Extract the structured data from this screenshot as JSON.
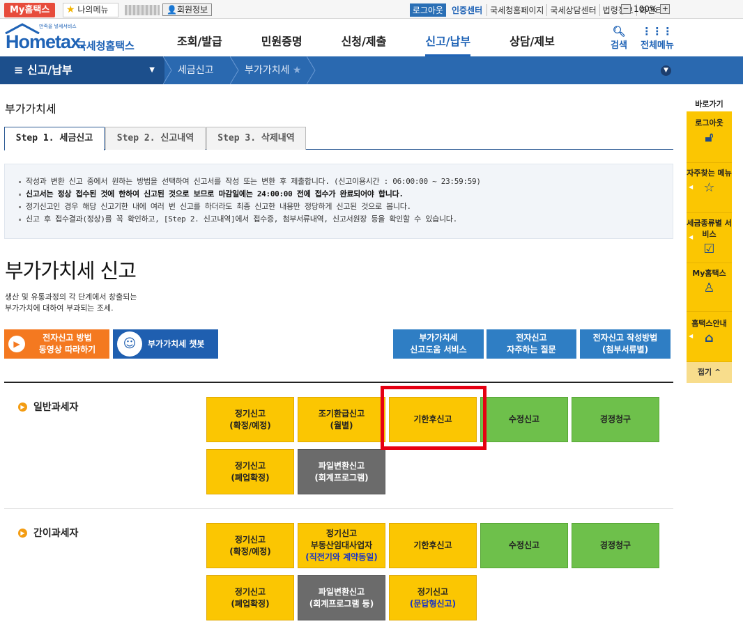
{
  "topbar": {
    "my_hometax": "My홈택스",
    "my_menu": "나의메뉴",
    "member_info": "회원정보",
    "logout": "로그아웃",
    "cert_center": "인증센터",
    "links": [
      "국세청홈페이지",
      "국세상담센터",
      "법령정보",
      "화면크기"
    ],
    "zoom": "100%"
  },
  "header": {
    "logo_text": "Hometax.",
    "logo_sub": "국세청홈택스",
    "logo_small": "만족을 넣세서비스",
    "menu": [
      "조회/발급",
      "민원증명",
      "신청/제출",
      "신고/납부",
      "상담/제보"
    ],
    "active_menu": "신고/납부",
    "search": "검색",
    "all_menu": "전체메뉴"
  },
  "navbar": {
    "first": "신고/납부",
    "crumbs": [
      "세금신고",
      "부가가치세"
    ]
  },
  "page_title": "부가가치세",
  "tabs": [
    "Step 1. 세금신고",
    "Step 2. 신고내역",
    "Step 3. 삭제내역"
  ],
  "notice": [
    "작성과 변환 신고 중에서 원하는 방법을 선택하여 신고서를 작성 또는 변환 후 제출합니다. (신고이용시간 : 06:00:00 ~ 23:59:59)",
    "신고서는 정상 접수된 것에 한하여 신고된 것으로 보므로 마감일에는 24:00:00 전에 접수가 완료되어야 합니다.",
    "정기신고인 경우 해당 신고기한 내에 여러 번 신고를 하더라도 최종 신고한 내용만 정당하게 신고된 것으로 봅니다.",
    "신고 후 접수결과(정상)를 꼭 확인하고, [Step 2. 신고내역]에서 접수증, 첨부서류내역, 신고서원장 등을 확인할 수 있습니다."
  ],
  "main": {
    "title": "부가가치세 신고",
    "desc_line1": "생산 및 유통과정의 각 단계에서 창출되는",
    "desc_line2": "부가가치에 대하여 부과되는 조세."
  },
  "helpers": {
    "video_l1": "전자신고 방법",
    "video_l2": "동영상 따라하기",
    "chatbot": "부가가치세 챗봇",
    "help_l1": "부가가치세",
    "help_l2": "신고도움 서비스",
    "faq_l1": "전자신고",
    "faq_l2": "자주하는 질문",
    "howto_l1": "전자신고 작성방법",
    "howto_l2": "(첨부서류별)"
  },
  "general": {
    "label": "일반과세자",
    "b1_l1": "정기신고",
    "b1_l2": "(확정/예정)",
    "b2_l1": "조기환급신고",
    "b2_l2": "(월별)",
    "b3": "기한후신고",
    "b4": "수정신고",
    "b5": "경정청구",
    "b6_l1": "정기신고",
    "b6_l2": "(폐업확정)",
    "b7_l1": "파일변환신고",
    "b7_l2": "(회계프로그램)"
  },
  "simple": {
    "label": "간이과세자",
    "b1_l1": "정기신고",
    "b1_l2": "(확정/예정)",
    "b2_l1": "정기신고",
    "b2_l2": "부동산임대사업자",
    "b2_l3": "(직전기와 계약동일)",
    "b3": "기한후신고",
    "b4": "수정신고",
    "b5": "경정청구",
    "b6_l1": "정기신고",
    "b6_l2": "(폐업확정)",
    "b7_l1": "파일변환신고",
    "b7_l2": "(회계프로그램 등)",
    "b8_l1": "정기신고",
    "b8_l2": "(문답형신고)"
  },
  "quick": {
    "title": "바로가기",
    "items": [
      "로그아웃",
      "자주찾는 메뉴",
      "세금종류별 서비스",
      "My홈택스",
      "홈택스안내"
    ],
    "close": "접기"
  },
  "colors": {
    "accent": "#1f63b6",
    "yellow": "#fbc602",
    "green": "#6ec04b",
    "gray": "#6b6b6b",
    "highlight": "#e60012"
  }
}
